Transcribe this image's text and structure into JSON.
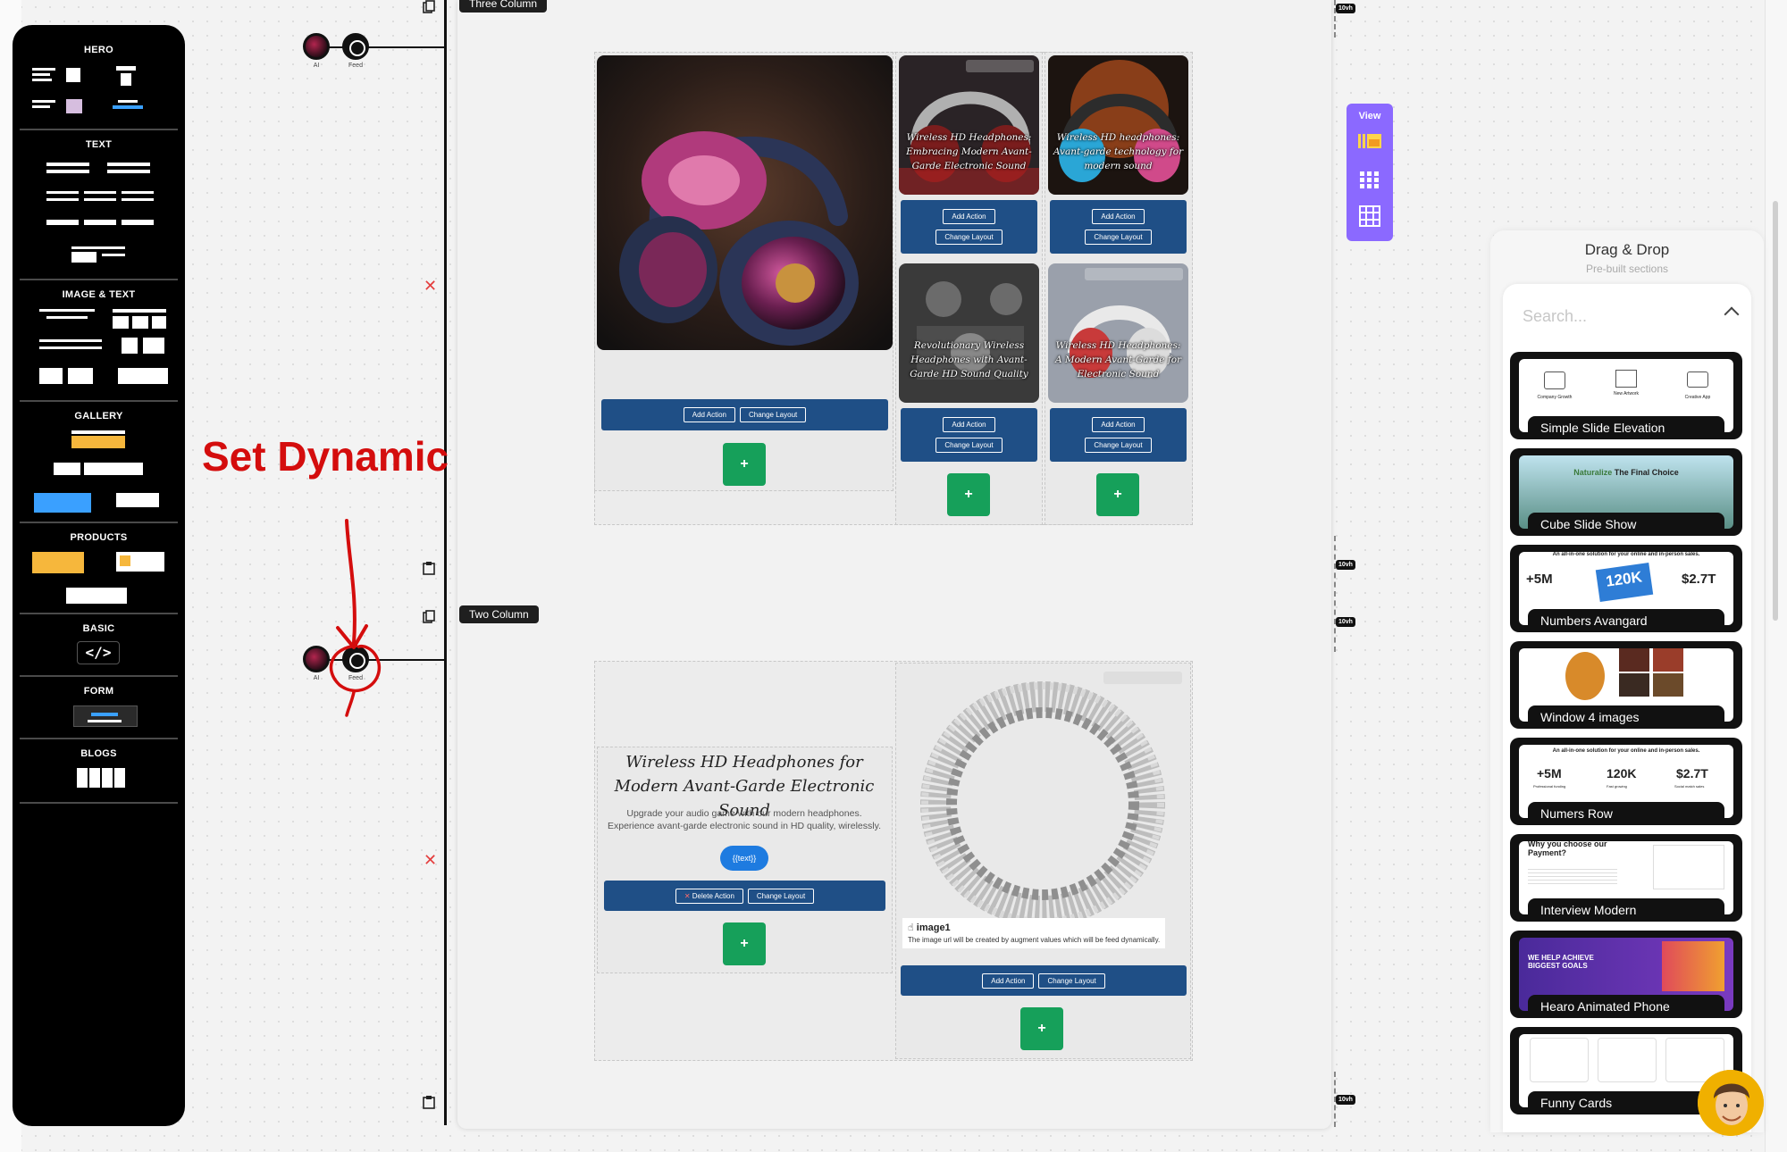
{
  "palette": {
    "sections": [
      {
        "id": "hero",
        "label": "HERO"
      },
      {
        "id": "text",
        "label": "TEXT"
      },
      {
        "id": "image_text",
        "label": "IMAGE & TEXT"
      },
      {
        "id": "gallery",
        "label": "GALLERY"
      },
      {
        "id": "products",
        "label": "PRODUCTS"
      },
      {
        "id": "basic",
        "label": "BASIC"
      },
      {
        "id": "form",
        "label": "FORM"
      },
      {
        "id": "blogs",
        "label": "BLOGS"
      }
    ],
    "code_glyph": "</>"
  },
  "timeline": {
    "ai_label": "AI",
    "feed_label": "Feed"
  },
  "sections": {
    "three_column": {
      "tag": "Three Column",
      "cards": [
        {
          "title": "Wireless HD Headphones: Embracing Modern Avant-Garde Electronic Sound"
        },
        {
          "title": "Wireless HD headphones: Avant-garde technology for modern sound"
        },
        {
          "title": "Revolutionary Wireless Headphones with Avant-Garde HD Sound Quality"
        },
        {
          "title": "Wireless HD Headphones: A Modern Avant-Garde for Electronic Sound"
        }
      ]
    },
    "two_column": {
      "tag": "Two Column",
      "heading": "Wireless HD Headphones for Modern Avant-Garde Electronic Sound",
      "body": "Upgrade your audio game with our modern headphones. Experience avant-garde electronic sound in HD quality, wirelessly.",
      "pill": "{{text}}",
      "image_caption_title": "image1",
      "image_caption_body": "The image url will be created by augment values which will be feed dynamically."
    },
    "vh_chip": "10vh"
  },
  "actions": {
    "add": "Add Action",
    "change": "Change Layout",
    "delete": "Delete Action",
    "plus": "+"
  },
  "annotation": {
    "text": "Set Dynamic Image",
    "color": "#d40d0d"
  },
  "view_panel": {
    "label": "View",
    "icons": [
      "grid-list-icon",
      "dots-grid-icon",
      "table-grid-icon"
    ]
  },
  "drag_drop": {
    "title": "Drag & Drop",
    "subtitle": "Pre-built sections",
    "search_placeholder": "Search...",
    "templates": [
      {
        "name": "Simple Slide Elevation",
        "labels": [
          "Company Growth",
          "New Artwork",
          "Creative App"
        ]
      },
      {
        "name": "Cube Slide Show",
        "headline_brand": "Naturalize",
        "headline_rest": " The Final Choice"
      },
      {
        "name": "Numbers Avangard",
        "headline": "An all-in-one solution for your online and in-person sales.",
        "stats": [
          "+5M",
          "120K",
          "$2.7T"
        ]
      },
      {
        "name": "Window 4 images"
      },
      {
        "name": "Numers Row",
        "headline": "An all-in-one solution for your online and in-person sales.",
        "stats": [
          "+5M",
          "120K",
          "$2.7T"
        ],
        "stat_labels": [
          "Professional funding",
          "Fast growing",
          "Social match sales"
        ]
      },
      {
        "name": "Interview Modern",
        "headline": "Why you choose our Payment?"
      },
      {
        "name": "Hearo Animated Phone",
        "headline": "WE HELP ACHIEVE BIGGEST GOALS"
      },
      {
        "name": "Funny Cards"
      }
    ]
  },
  "colors": {
    "accent_blue": "#1f4f86",
    "plus_green": "#16a05a",
    "view_purple": "#8b69ff"
  }
}
